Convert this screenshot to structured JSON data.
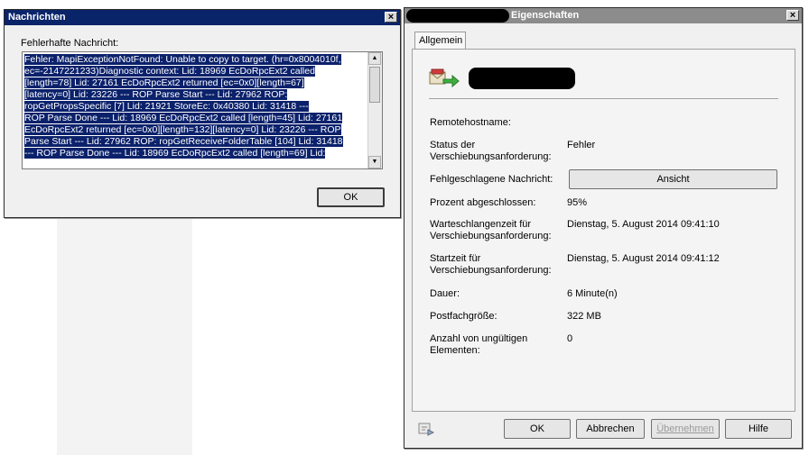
{
  "messages_dialog": {
    "title": "Nachrichten",
    "close_glyph": "×",
    "field_label": "Fehlerhafte Nachricht:",
    "message_lines": [
      "Fehler: MapiExceptionNotFound: Unable to copy to target. (hr=0x8004010f,",
      "ec=-2147221233)Diagnostic context:    Lid: 18969   EcDoRpcExt2 called",
      "[length=78]    Lid: 27161   EcDoRpcExt2 returned [ec=0x0][length=67]",
      "[latency=0]    Lid: 23226   --- ROP Parse Start ---    Lid: 27962   ROP:",
      "ropGetPropsSpecific [7]    Lid: 21921   StoreEc: 0x40380       Lid: 31418   ---",
      "ROP Parse Done ---    Lid: 18969   EcDoRpcExt2 called [length=45]    Lid: 27161",
      "  EcDoRpcExt2 returned [ec=0x0][length=132][latency=0]    Lid: 23226   --- ROP",
      "Parse Start ---    Lid: 27962   ROP: ropGetReceiveFolderTable [104]    Lid: 31418",
      " --- ROP Parse Done ---    Lid: 18969   EcDoRpcExt2 called [length=69]    Lid:"
    ],
    "ok_label": "OK"
  },
  "properties_dialog": {
    "title": "Eigenschaften",
    "close_glyph": "×",
    "tab_label": "Allgemein",
    "rows": [
      {
        "label": "Remotehostname:",
        "value": ""
      },
      {
        "label": "Status der Verschiebungsanforderung:",
        "value": "Fehler"
      },
      {
        "label": "Fehlgeschlagene Nachricht:",
        "value": ""
      },
      {
        "label": "Prozent abgeschlossen:",
        "value": "95%"
      },
      {
        "label": "Warteschlangenzeit für Verschiebungsanforderung:",
        "value": "Dienstag, 5. August 2014 09:41:10"
      },
      {
        "label": "Startzeit für Verschiebungsanforderung:",
        "value": "Dienstag, 5. August 2014 09:41:12"
      },
      {
        "label": "Dauer:",
        "value": "6 Minute(n)"
      },
      {
        "label": "Postfachgröße:",
        "value": "322 MB"
      },
      {
        "label": "Anzahl von ungültigen Elementen:",
        "value": "0"
      }
    ],
    "view_button_label": "Ansicht",
    "buttons": {
      "ok": "OK",
      "cancel": "Abbrechen",
      "apply": "Übernehmen",
      "help": "Hilfe"
    }
  }
}
